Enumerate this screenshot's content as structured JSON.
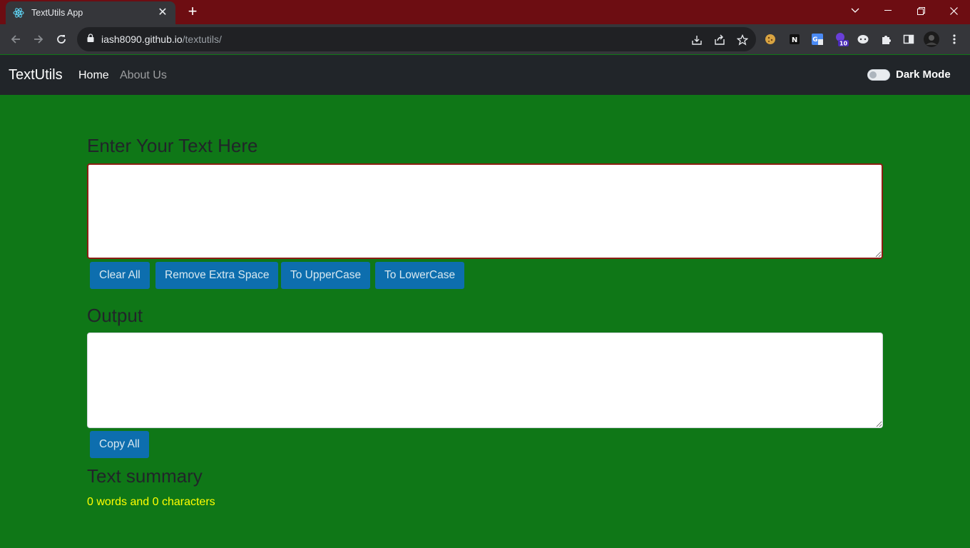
{
  "browser": {
    "tab_title": "TextUtils App",
    "url_host": "iash8090.github.io",
    "url_path": "/textutils/",
    "extension_badge": "10"
  },
  "navbar": {
    "brand": "TextUtils",
    "links": [
      "Home",
      "About Us"
    ],
    "dark_mode_label": "Dark Mode",
    "dark_mode_on": false
  },
  "input_section": {
    "heading": "Enter Your Text Here",
    "value": ""
  },
  "buttons": [
    "Clear All",
    "Remove Extra Space",
    "To UpperCase",
    "To LowerCase"
  ],
  "output_section": {
    "heading": "Output",
    "value": "",
    "copy_label": "Copy All"
  },
  "summary": {
    "heading": "Text summary",
    "text": "0 words and 0 characters"
  },
  "colors": {
    "page_bg": "#0f7717",
    "navbar_bg": "#212529",
    "button_bg": "#0d6eae",
    "summary_text": "#ffff00",
    "tabstrip_bg": "#6d0d12"
  }
}
